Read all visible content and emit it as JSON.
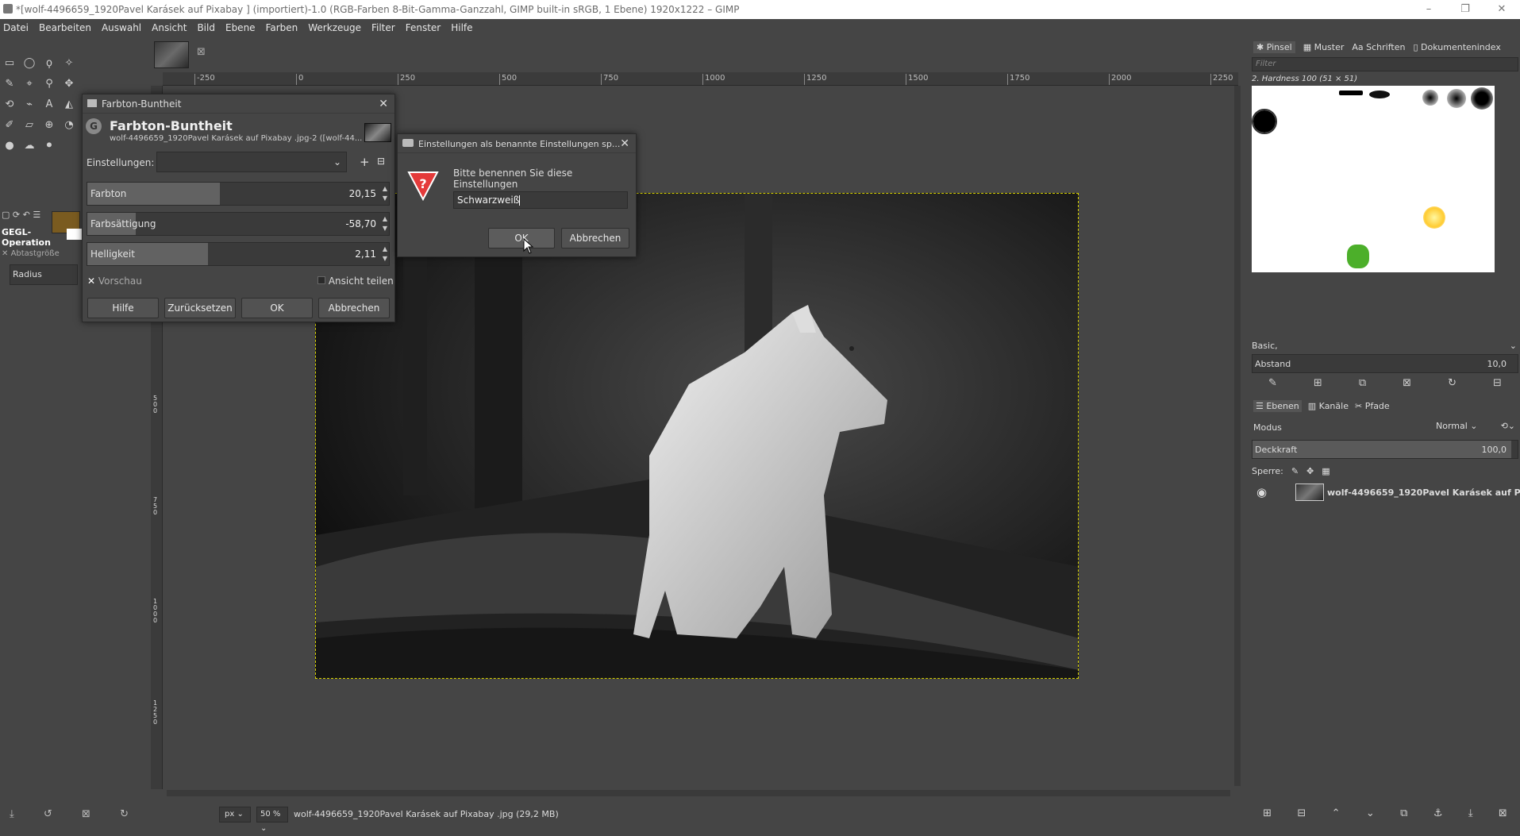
{
  "window": {
    "title": "*[wolf-4496659_1920Pavel Karásek auf Pixabay ] (importiert)-1.0 (RGB-Farben 8-Bit-Gamma-Ganzzahl, GIMP built-in sRGB, 1 Ebene) 1920x1222 – GIMP",
    "controls": [
      "–",
      "❐",
      "✕"
    ]
  },
  "menu": [
    "Datei",
    "Bearbeiten",
    "Auswahl",
    "Ansicht",
    "Bild",
    "Ebene",
    "Farben",
    "Werkzeuge",
    "Filter",
    "Fenster",
    "Hilfe"
  ],
  "tool_options": {
    "title": "GEGL-Operation",
    "sample_size": "Abtastgröße",
    "radius": "Radius"
  },
  "ruler": {
    "labels": [
      "-250",
      "0",
      "250",
      "500",
      "750",
      "1000",
      "1250",
      "1500",
      "1750",
      "2000",
      "2250"
    ],
    "vlabels": [
      "5\n0\n0",
      "7\n5\n0",
      "1\n0\n0\n0",
      "1\n2\n5\n0"
    ]
  },
  "status": {
    "unit": "px",
    "zoom": "50 %",
    "info": "wolf-4496659_1920Pavel Karásek auf Pixabay .jpg (29,2 MB)"
  },
  "hue_dialog": {
    "window_title": "Farbton-Buntheit",
    "heading": "Farbton-Buntheit",
    "subtitle": "wolf-4496659_1920Pavel Karásek auf Pixabay .jpg-2 ([wolf-44...",
    "settings_label": "Einstellungen:",
    "sliders": [
      {
        "label": "Farbton",
        "value": "20,15",
        "fraction": 0.44
      },
      {
        "label": "Farbsättigung",
        "value": "-58,70",
        "fraction": 0.16
      },
      {
        "label": "Helligkeit",
        "value": "2,11",
        "fraction": 0.4
      }
    ],
    "preview_label": "Vorschau",
    "split_label": "Ansicht teilen",
    "buttons": {
      "help": "Hilfe",
      "reset": "Zurücksetzen",
      "ok": "OK",
      "cancel": "Abbrechen"
    }
  },
  "save_dialog": {
    "window_title": "Einstellungen als benannte Einstellungen sp...",
    "prompt": "Bitte benennen Sie diese Einstellungen",
    "name_value": "Schwarzweiß",
    "ok": "OK",
    "cancel": "Abbrechen"
  },
  "brushes_dock": {
    "tabs": [
      "Pinsel",
      "Muster",
      "Schriften",
      "Dokumentenindex"
    ],
    "filter_placeholder": "Filter",
    "brush_name": "2. Hardness 100 (51 × 51)",
    "tag": "Basic,",
    "spacing_label": "Abstand",
    "spacing_value": "10,0"
  },
  "layers_dock": {
    "tabs": [
      "Ebenen",
      "Kanäle",
      "Pfade"
    ],
    "mode_label": "Modus",
    "mode_value": "Normal",
    "opacity_label": "Deckkraft",
    "opacity_value": "100,0",
    "lock_label": "Sperre:",
    "layer_name": "wolf-4496659_1920Pavel Karásek auf P"
  }
}
